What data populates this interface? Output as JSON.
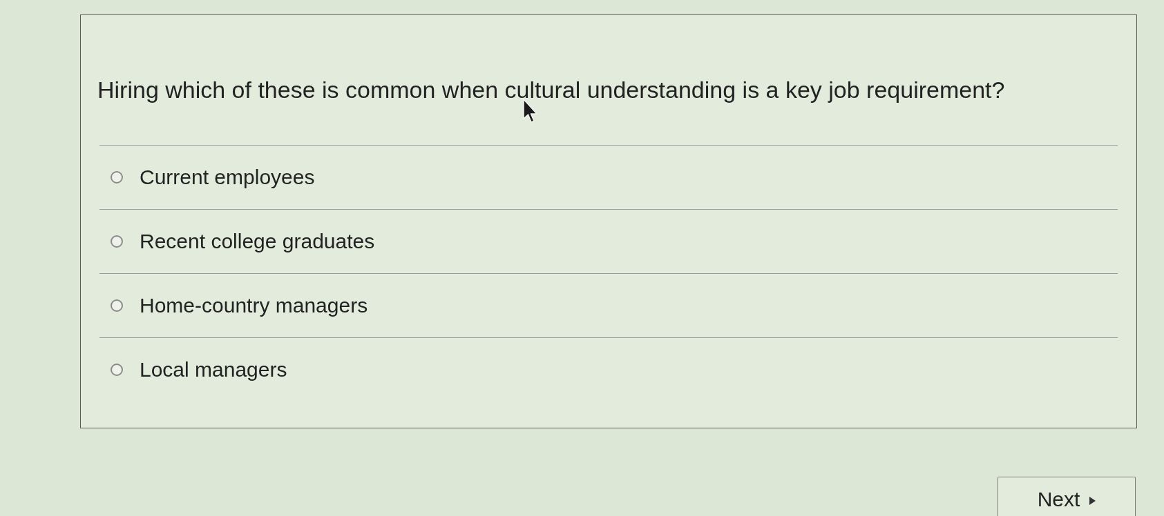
{
  "question": {
    "text": "Hiring which of these is common when cultural understanding is a key job requirement?"
  },
  "options": [
    {
      "label": "Current employees",
      "selected": false
    },
    {
      "label": "Recent college graduates",
      "selected": false
    },
    {
      "label": "Home-country managers",
      "selected": false
    },
    {
      "label": "Local managers",
      "selected": false
    }
  ],
  "next_button": {
    "label": "Next"
  }
}
